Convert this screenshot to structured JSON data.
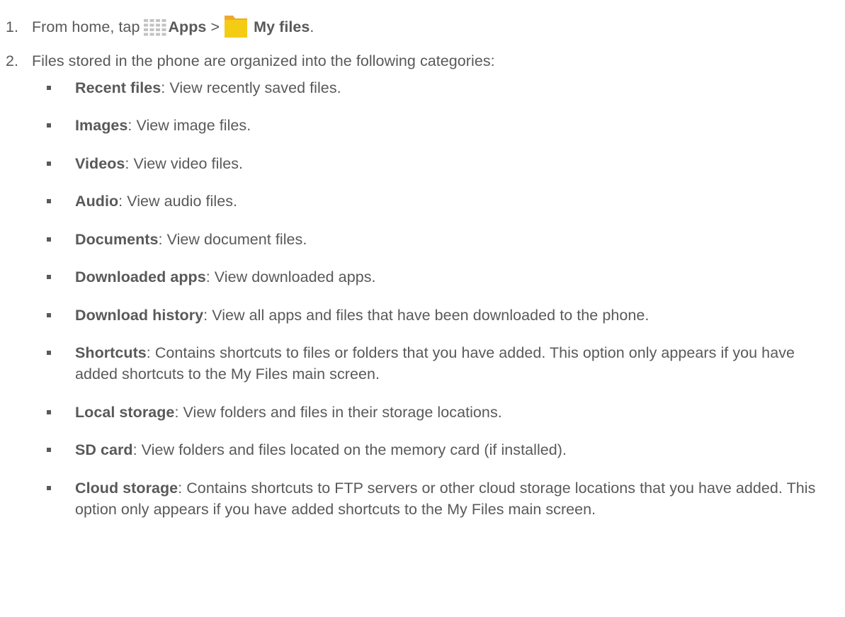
{
  "steps": [
    {
      "number": "1.",
      "text_a": "From home, tap",
      "apps_label": "Apps",
      "separator": ">",
      "myfiles_label": "My files",
      "end": "."
    },
    {
      "number": "2.",
      "text": "Files stored in the phone are organized into the following categories:"
    }
  ],
  "icons": {
    "apps": "apps-grid-icon",
    "myfiles": "folder-icon",
    "folder_color": "#f5cc14",
    "folder_tab_color": "#f0a830"
  },
  "categories": [
    {
      "name": "Recent files",
      "desc": ": View recently saved files."
    },
    {
      "name": "Images",
      "desc": ": View image files."
    },
    {
      "name": "Videos",
      "desc": ": View video files."
    },
    {
      "name": "Audio",
      "desc": ": View audio files."
    },
    {
      "name": "Documents",
      "desc": ": View document files."
    },
    {
      "name": "Downloaded apps",
      "desc": ": View downloaded apps."
    },
    {
      "name": "Download history",
      "desc": ": View all apps and files that have been downloaded to the phone."
    },
    {
      "name": "Shortcuts",
      "desc": ": Contains shortcuts to files or folders that you have added. This option only appears if you have added shortcuts to the My Files main screen."
    },
    {
      "name": "Local storage",
      "desc": ": View folders and files in their storage locations."
    },
    {
      "name": "SD card",
      "desc": ": View folders and files located on the memory card (if installed)."
    },
    {
      "name": "Cloud storage",
      "desc": ": Contains shortcuts to FTP servers or other cloud storage locations that you have added. This option only appears if you have added shortcuts to the My Files main screen."
    }
  ]
}
